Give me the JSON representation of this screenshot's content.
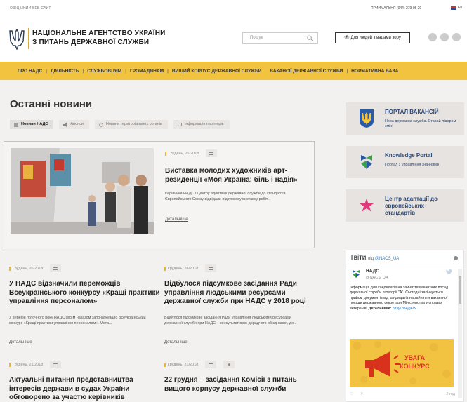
{
  "topbar": {
    "official": "ОФІЦІЙНИЙ ВЕБ-САЙТ",
    "phone": "ПРИЙМАЛЬНЯ (044) 279 05 29",
    "lang": "En"
  },
  "header": {
    "agency_line1": "НАЦІОНАЛЬНЕ АГЕНТСТВО УКРАЇНИ",
    "agency_line2": "З ПИТАНЬ ДЕРЖАВНОЇ СЛУЖБИ",
    "search_placeholder": "Пошук",
    "accessibility_label": "Для людей з вадами зору"
  },
  "nav": [
    "ПРО НАДС",
    "ДІЯЛЬНІСТЬ",
    "СЛУЖБОВЦЯМ",
    "ГРОМАДЯНАМ",
    "ВИЩИЙ КОРПУС ДЕРЖАВНОЇ СЛУЖБИ",
    "ВАКАНСІЇ ДЕРЖАВНОЇ СЛУЖБИ",
    "НОРМАТИВНА БАЗА"
  ],
  "main": {
    "title": "Останні новини",
    "tabs": [
      "Новини НАДС",
      "Анонси",
      "Новини територіальних органів",
      "Інформація партнерів"
    ],
    "more_label": "Детальніше"
  },
  "featured": {
    "date": "Грудень, 26/2018",
    "title": "Виставка молодих художників арт-резиденції «Моя Україна: біль і надія»",
    "text": "Керівники НАДС і Центру адаптації державної служби до стандартів Європейського Союзу відвідали підсумкову виставку робіт..."
  },
  "cards": [
    {
      "date": "Грудень, 26/2018",
      "title": "У НАДС відзначили переможців Всеукраїнського конкурсу «Кращі практики управління персоналом»",
      "text": "У вересні поточного року НАДС своїм наказом започаткувало Всеукраїнський конкурс «Кращі практики управління персоналом». Мета..."
    },
    {
      "date": "Грудень, 26/2018",
      "title": "Відбулося підсумкове засідання Ради управління людськими ресурсами державної служби при НАДС у 2018 році",
      "text": "Відбулося підсумкове засідання Ради управління людськими ресурсами державної служби при НАДС – консультативно-дорадчого об'єднання, до..."
    },
    {
      "date": "Грудень, 21/2018",
      "title": "Актуальні питання представництва інтересів держави в судах України обговорено за участю керівників"
    },
    {
      "date": "Грудень, 21/2018",
      "title": "22 грудня – засідання Комісії з питань вищого корпусу державної служби"
    }
  ],
  "sidebar": {
    "vacancies_title": "ПОРТАЛ ВАКАНСІЙ",
    "vacancies_sub": "Нова державна служба. Ставай лідером змін!",
    "knowledge_title": "Knowledge Portal",
    "knowledge_sub": "Портал з управління знаннями",
    "center_title": "Центр адаптації до європейських стандартів"
  },
  "tweets": {
    "title": "Твіти",
    "from_label": "від",
    "handle_link": "@NACS_UA",
    "account_name": "НАДС",
    "account_handle": "@NACS_UA",
    "text": "Інформація для кандидатів на зайняття вакантних посад державної служби категорії \"А\". Сьогодні закінчується прийом документів від кандидатів на зайняття вакантної посади державного секретаря Міністерства у справах ветеранів.",
    "details_label": "Детальніше:",
    "link": "bit.ly/2B4jgFW",
    "promo_line1": "УВАГА",
    "promo_line2": "КОНКУРС",
    "time": "2 год"
  },
  "colors": {
    "accent": "#f1c33f",
    "brand_blue": "#2b4a7c",
    "alert_red": "#d8321c"
  }
}
